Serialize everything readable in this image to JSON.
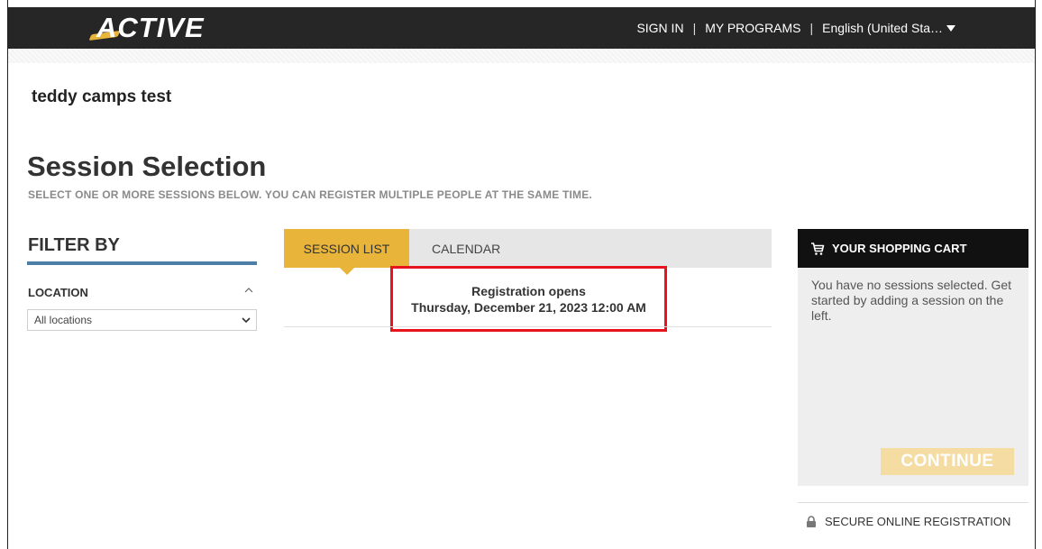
{
  "header": {
    "logo_text": "ACTIVE",
    "nav": {
      "sign_in": "SIGN IN",
      "separator": "|",
      "my_programs": "MY PROGRAMS",
      "language": "English (United Sta…"
    }
  },
  "org": {
    "name": "teddy camps test"
  },
  "page": {
    "title": "Session Selection",
    "subtitle": "SELECT ONE OR MORE SESSIONS BELOW. YOU CAN REGISTER MULTIPLE PEOPLE AT THE SAME TIME."
  },
  "filter": {
    "title": "FILTER BY",
    "location_label": "LOCATION",
    "location_value": "All locations"
  },
  "tabs": [
    {
      "label": "SESSION LIST",
      "active": true
    },
    {
      "label": "CALENDAR",
      "active": false
    }
  ],
  "registration": {
    "line1": "Registration opens",
    "line2": "Thursday, December 21, 2023 12:00 AM"
  },
  "cart": {
    "title": "YOUR SHOPPING CART",
    "empty_text": "You have no sessions selected. Get started by adding a session on the left.",
    "continue_label": "CONTINUE"
  },
  "secure": {
    "label": "SECURE ONLINE REGISTRATION"
  },
  "colors": {
    "accent": "#e8b43a",
    "header_bg": "#262626",
    "filter_rule": "#4d7fa6",
    "highlight_border": "#e8141d",
    "continue_disabled": "#f4dca3"
  },
  "icons": {
    "cart": "shopping-cart-icon",
    "lock": "lock-icon",
    "location_toggle": "chevron-up-icon",
    "select_arrow": "chevron-down-icon",
    "language_caret": "caret-down-icon"
  }
}
